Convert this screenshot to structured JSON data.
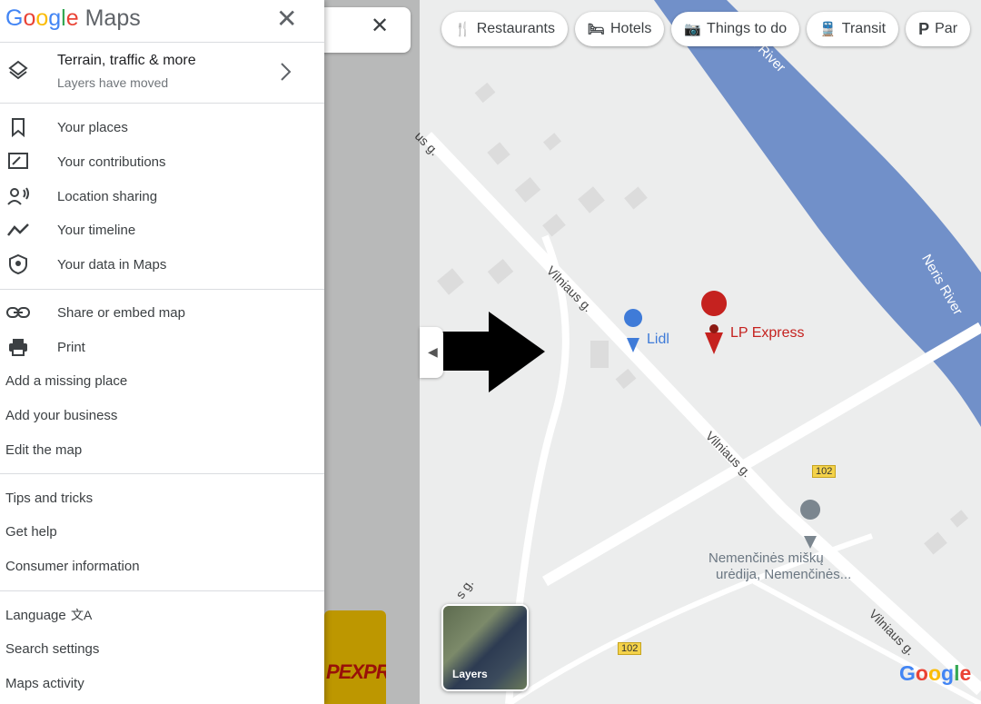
{
  "app": {
    "logo_google": "Google",
    "logo_maps": "Maps"
  },
  "search": {
    "close_icon": "close-icon"
  },
  "chips": [
    {
      "label": "Restaurants",
      "icon": "restaurant-icon"
    },
    {
      "label": "Hotels",
      "icon": "hotel-icon"
    },
    {
      "label": "Things to do",
      "icon": "camera-icon"
    },
    {
      "label": "Transit",
      "icon": "transit-icon"
    },
    {
      "label": "Par",
      "icon": "parking-icon"
    }
  ],
  "menu": {
    "terrain": {
      "title": "Terrain, traffic & more",
      "subtitle": "Layers have moved"
    },
    "personal": [
      {
        "label": "Your places",
        "icon": "bookmark-icon"
      },
      {
        "label": "Your contributions",
        "icon": "contributions-icon"
      },
      {
        "label": "Location sharing",
        "icon": "location-sharing-icon"
      },
      {
        "label": "Your timeline",
        "icon": "timeline-icon"
      },
      {
        "label": "Your data in Maps",
        "icon": "shield-icon"
      }
    ],
    "share": [
      {
        "label": "Share or embed map",
        "icon": "link-icon"
      },
      {
        "label": "Print",
        "icon": "print-icon"
      }
    ],
    "edit": [
      "Add a missing place",
      "Add your business",
      "Edit the map"
    ],
    "help": [
      "Tips and tricks",
      "Get help",
      "Consumer information"
    ],
    "settings": [
      "Language",
      "Search settings",
      "Maps activity"
    ]
  },
  "map": {
    "labels": {
      "river_top": "s River",
      "river_right": "Neris River",
      "road1": "Vilniaus g.",
      "road2": "Vilniaus g.",
      "road3": "Vilniaus g.",
      "road_top_left": "us g.",
      "road_bottom_left": "s g.",
      "road_number1": "102",
      "road_number2": "102",
      "lidl": "Lidl",
      "lp_express": "LP Express",
      "forest_line1": "Nemenčinės miškų",
      "forest_line2": "urėdija, Nemenčinės...",
      "billboard": "PEXPR"
    },
    "layers_label": "Layers",
    "google_logo": "Google"
  },
  "colors": {
    "river": "#7190c9",
    "panel_bg": "#ffffff",
    "annotation_red": "#e8453c",
    "pin_red": "#c5221f",
    "lidl_blue": "#3f7bd8"
  }
}
